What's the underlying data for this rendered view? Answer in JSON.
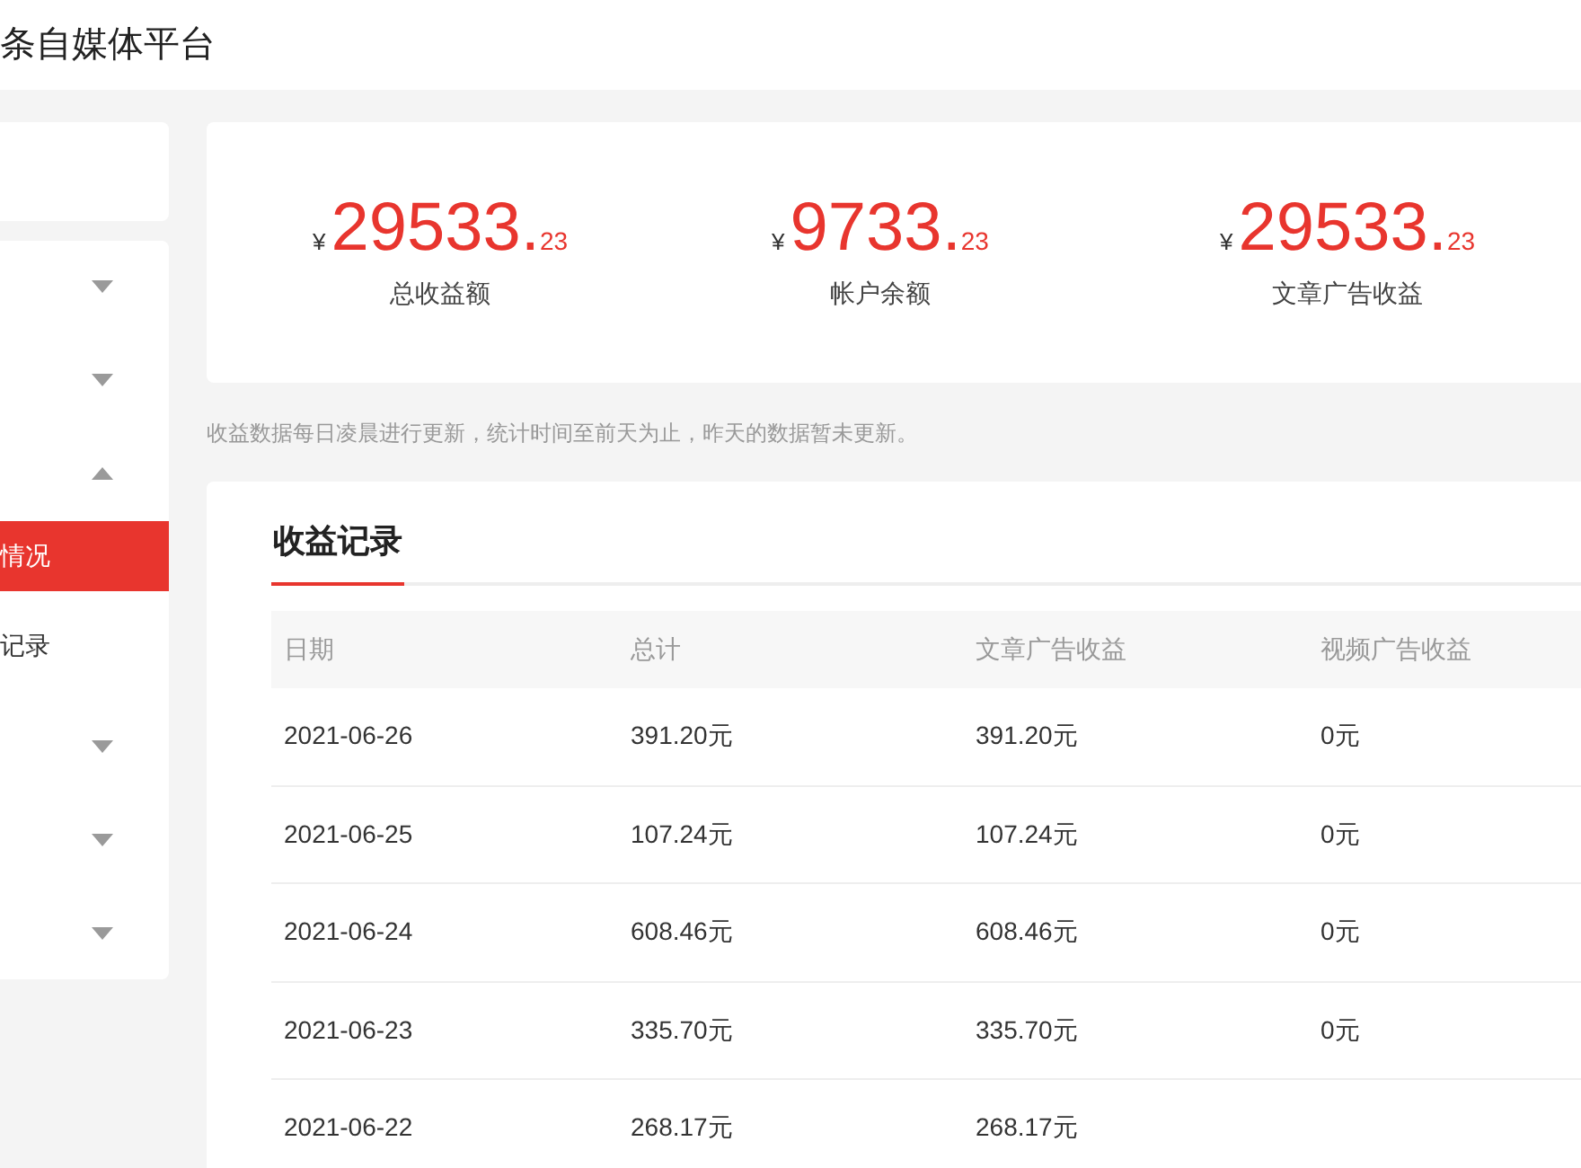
{
  "header": {
    "title": "条自媒体平台"
  },
  "sidebar": {
    "items": [
      {
        "expanded": false
      },
      {
        "expanded": false
      },
      {
        "expanded": true,
        "children": [
          {
            "label": "情况",
            "selected": true
          },
          {
            "label": "记录",
            "selected": false
          }
        ]
      },
      {
        "expanded": false
      },
      {
        "expanded": false
      },
      {
        "expanded": false
      }
    ]
  },
  "stats": [
    {
      "currency": "¥",
      "integer": "29533",
      "decimal": ".",
      "fraction": "23",
      "label": "总收益额"
    },
    {
      "currency": "¥",
      "integer": "9733",
      "decimal": ".",
      "fraction": "23",
      "label": "帐户余额"
    },
    {
      "currency": "¥",
      "integer": "29533",
      "decimal": ".",
      "fraction": "23",
      "label": "文章广告收益"
    }
  ],
  "note": "收益数据每日凌晨进行更新，统计时间至前天为止，昨天的数据暂未更新。",
  "records": {
    "tabs": [
      {
        "label": "收益记录",
        "selected": true
      }
    ],
    "table": {
      "columns": [
        "日期",
        "总计",
        "文章广告收益",
        "视频广告收益"
      ],
      "rows": [
        [
          "2021-06-26",
          "391.20元",
          "391.20元",
          "0元"
        ],
        [
          "2021-06-25",
          "107.24元",
          "107.24元",
          "0元"
        ],
        [
          "2021-06-24",
          "608.46元",
          "608.46元",
          "0元"
        ],
        [
          "2021-06-23",
          "335.70元",
          "335.70元",
          "0元"
        ],
        [
          "2021-06-22",
          "268.17元",
          "268.17元"
        ]
      ]
    }
  }
}
